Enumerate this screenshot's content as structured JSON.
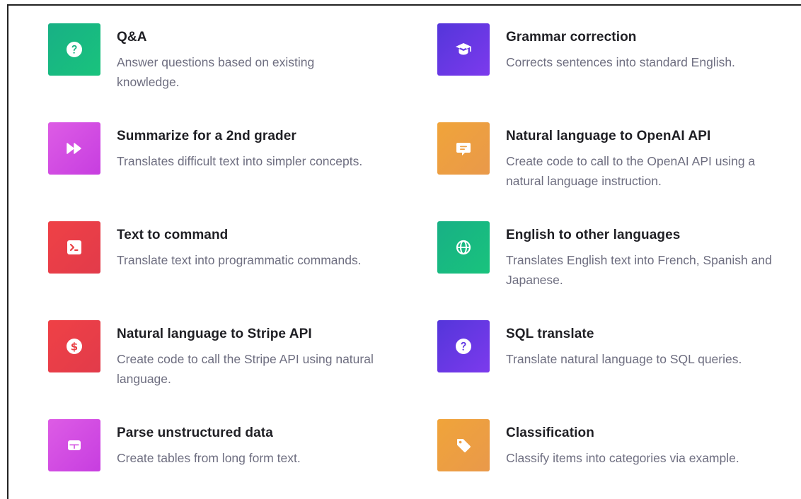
{
  "examples": [
    {
      "title": "Q&A",
      "description": "Answer questions based on existing knowledge.",
      "icon": "question-icon",
      "color": "#19c37d"
    },
    {
      "title": "Grammar correction",
      "description": "Corrects sentences into standard English.",
      "icon": "graduation-cap-icon",
      "color": "#5436da"
    },
    {
      "title": "Summarize for a 2nd grader",
      "description": "Translates difficult text into simpler concepts.",
      "icon": "fast-forward-icon",
      "color": "#dd5ce5"
    },
    {
      "title": "Natural language to OpenAI API",
      "description": "Create code to call to the OpenAI API using a natural language instruction.",
      "icon": "message-icon",
      "color": "#f0a43a"
    },
    {
      "title": "Text to command",
      "description": "Translate text into programmatic commands.",
      "icon": "terminal-icon",
      "color": "#ef4146"
    },
    {
      "title": "English to other languages",
      "description": "Translates English text into French, Spanish and Japanese.",
      "icon": "globe-icon",
      "color": "#19c37d"
    },
    {
      "title": "Natural language to Stripe API",
      "description": "Create code to call the Stripe API using natural language.",
      "icon": "dollar-icon",
      "color": "#ef4146"
    },
    {
      "title": "SQL translate",
      "description": "Translate natural language to SQL queries.",
      "icon": "question-icon",
      "color": "#5436da"
    },
    {
      "title": "Parse unstructured data",
      "description": "Create tables from long form text.",
      "icon": "table-icon",
      "color": "#dd5ce5"
    },
    {
      "title": "Classification",
      "description": "Classify items into categories via example.",
      "icon": "tag-icon",
      "color": "#f0a43a"
    }
  ]
}
